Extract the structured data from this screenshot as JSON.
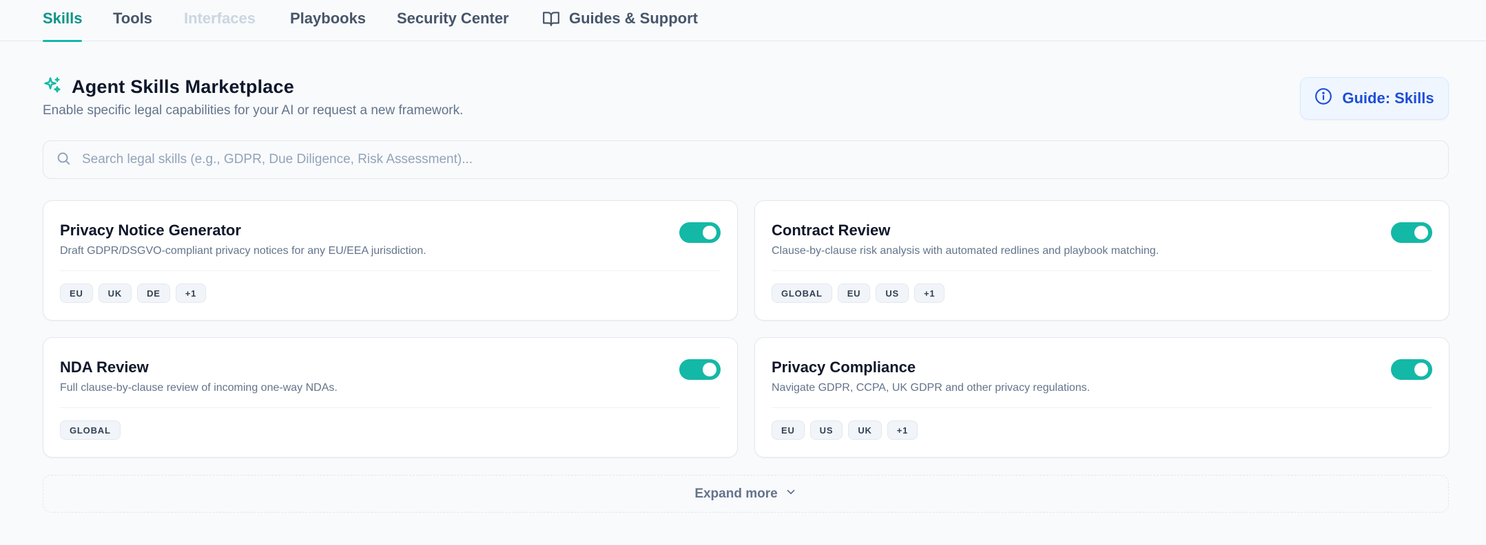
{
  "nav": {
    "tabs": [
      {
        "label": "Skills"
      },
      {
        "label": "Tools"
      },
      {
        "label": "Interfaces"
      },
      {
        "label": "Playbooks"
      },
      {
        "label": "Security Center"
      },
      {
        "label": "Guides & Support"
      }
    ],
    "active_tab": "Skills"
  },
  "header": {
    "title": "Agent Skills Marketplace",
    "subtitle": "Enable specific legal capabilities for your AI or request a new framework.",
    "guide_button": "Guide: Skills"
  },
  "search": {
    "placeholder": "Search legal skills (e.g., GDPR, Due Diligence, Risk Assessment)..."
  },
  "skills": [
    {
      "title": "Privacy Notice Generator",
      "description": "Draft GDPR/DSGVO-compliant privacy notices for any EU/EEA jurisdiction.",
      "enabled": true,
      "tags": [
        "EU",
        "UK",
        "DE",
        "+1"
      ]
    },
    {
      "title": "Contract Review",
      "description": "Clause-by-clause risk analysis with automated redlines and playbook matching.",
      "enabled": true,
      "tags": [
        "GLOBAL",
        "EU",
        "US",
        "+1"
      ]
    },
    {
      "title": "NDA Review",
      "description": "Full clause-by-clause review of incoming one-way NDAs.",
      "enabled": true,
      "tags": [
        "GLOBAL"
      ]
    },
    {
      "title": "Privacy Compliance",
      "description": "Navigate GDPR, CCPA, UK GDPR and other privacy regulations.",
      "enabled": true,
      "tags": [
        "EU",
        "US",
        "UK",
        "+1"
      ]
    }
  ],
  "expand": {
    "label": "Expand more"
  },
  "colors": {
    "accent": "#14b8a6",
    "accent_text": "#0d9488",
    "guide_text": "#1d4ed8",
    "guide_bg": "#eff6ff"
  }
}
